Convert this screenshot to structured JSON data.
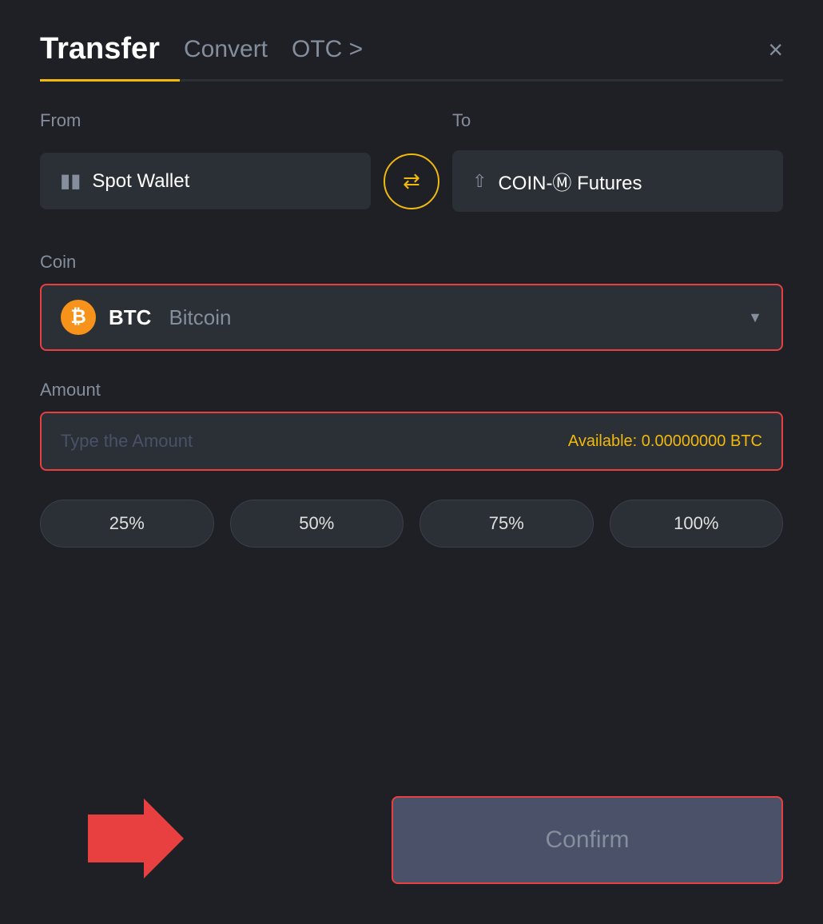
{
  "modal": {
    "tabs": [
      {
        "id": "transfer",
        "label": "Transfer",
        "active": true
      },
      {
        "id": "convert",
        "label": "Convert",
        "active": false
      },
      {
        "id": "otc",
        "label": "OTC >",
        "active": false
      }
    ],
    "close_label": "×",
    "from_label": "From",
    "to_label": "To",
    "from_wallet": "Spot Wallet",
    "to_wallet": "COIN-Ⓜ Futures",
    "swap_icon": "⇄",
    "coin_label": "Coin",
    "coin_ticker": "BTC",
    "coin_name": "Bitcoin",
    "amount_label": "Amount",
    "amount_placeholder": "Type the Amount",
    "available_label": "Available:",
    "available_value": "0.00000000",
    "available_currency": "BTC",
    "percent_buttons": [
      "25%",
      "50%",
      "75%",
      "100%"
    ],
    "confirm_label": "Confirm"
  }
}
